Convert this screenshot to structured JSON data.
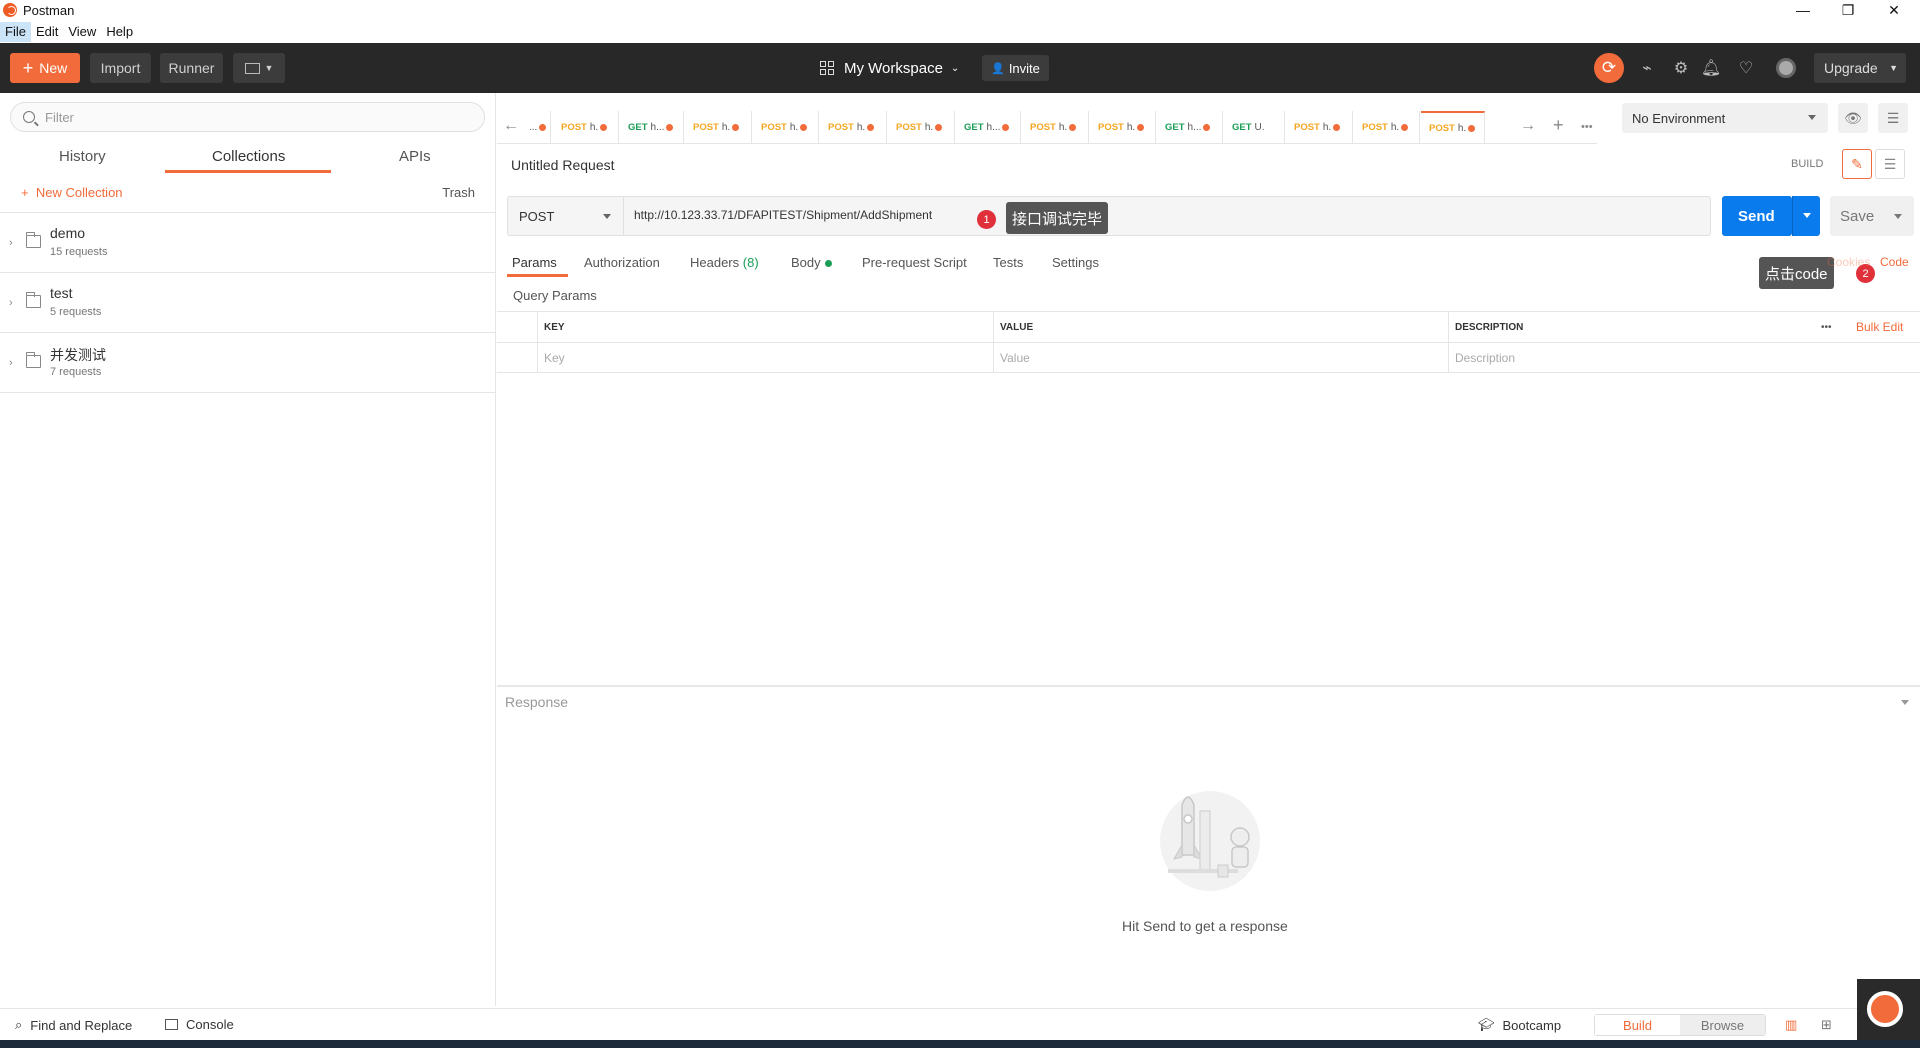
{
  "window": {
    "title": "Postman",
    "min": "—",
    "max": "❐",
    "close": "✕"
  },
  "menu": [
    "File",
    "Edit",
    "View",
    "Help"
  ],
  "header": {
    "new_label": "New",
    "import_label": "Import",
    "runner_label": "Runner",
    "workspace_label": "My Workspace",
    "invite_label": "Invite",
    "upgrade_label": "Upgrade"
  },
  "sidebar": {
    "filter_placeholder": "Filter",
    "tabs": [
      "History",
      "Collections",
      "APIs"
    ],
    "active_tab": "Collections",
    "new_collection": "New Collection",
    "trash": "Trash",
    "collections": [
      {
        "name": "demo",
        "count": "15 requests"
      },
      {
        "name": "test",
        "count": "5 requests"
      },
      {
        "name": "并发测试",
        "count": "7 requests"
      }
    ]
  },
  "tabs": [
    {
      "method": "",
      "name": "..."
    },
    {
      "method": "POST",
      "name": "h."
    },
    {
      "method": "GET",
      "name": "h..."
    },
    {
      "method": "POST",
      "name": "h."
    },
    {
      "method": "POST",
      "name": "h."
    },
    {
      "method": "POST",
      "name": "h."
    },
    {
      "method": "POST",
      "name": "h."
    },
    {
      "method": "GET",
      "name": "h..."
    },
    {
      "method": "POST",
      "name": "h."
    },
    {
      "method": "POST",
      "name": "h."
    },
    {
      "method": "GET",
      "name": "h..."
    },
    {
      "method": "GET",
      "name": "U."
    },
    {
      "method": "POST",
      "name": "h."
    },
    {
      "method": "POST",
      "name": "h."
    },
    {
      "method": "POST",
      "name": "h."
    }
  ],
  "environment": "No Environment",
  "request": {
    "name": "Untitled Request",
    "build_label": "BUILD",
    "method": "POST",
    "url": "http://10.123.33.71/DFAPITEST/Shipment/AddShipment",
    "send_label": "Send",
    "save_label": "Save"
  },
  "annotations": [
    {
      "num": "1",
      "text": "接口调试完毕"
    },
    {
      "num": "2",
      "text": "点击code"
    }
  ],
  "subtabs": {
    "params": "Params",
    "authorization": "Authorization",
    "headers": "Headers",
    "headers_count": "(8)",
    "body": "Body",
    "prerequest": "Pre-request Script",
    "tests": "Tests",
    "settings": "Settings",
    "cookies": "Cookies",
    "code": "Code"
  },
  "params": {
    "title": "Query Params",
    "headers": {
      "key": "KEY",
      "value": "VALUE",
      "description": "DESCRIPTION"
    },
    "more": "•••",
    "bulk_edit": "Bulk Edit",
    "placeholders": {
      "key": "Key",
      "value": "Value",
      "description": "Description"
    }
  },
  "response": {
    "label": "Response",
    "empty": "Hit Send to get a response"
  },
  "statusbar": {
    "find_replace": "Find and Replace",
    "console": "Console",
    "bootcamp": "Bootcamp",
    "build": "Build",
    "browse": "Browse"
  },
  "colors": {
    "accent": "#f26b3a",
    "send": "#097bed",
    "header_bg": "#282828",
    "get": "#1a9e56",
    "post": "#f5a623"
  }
}
